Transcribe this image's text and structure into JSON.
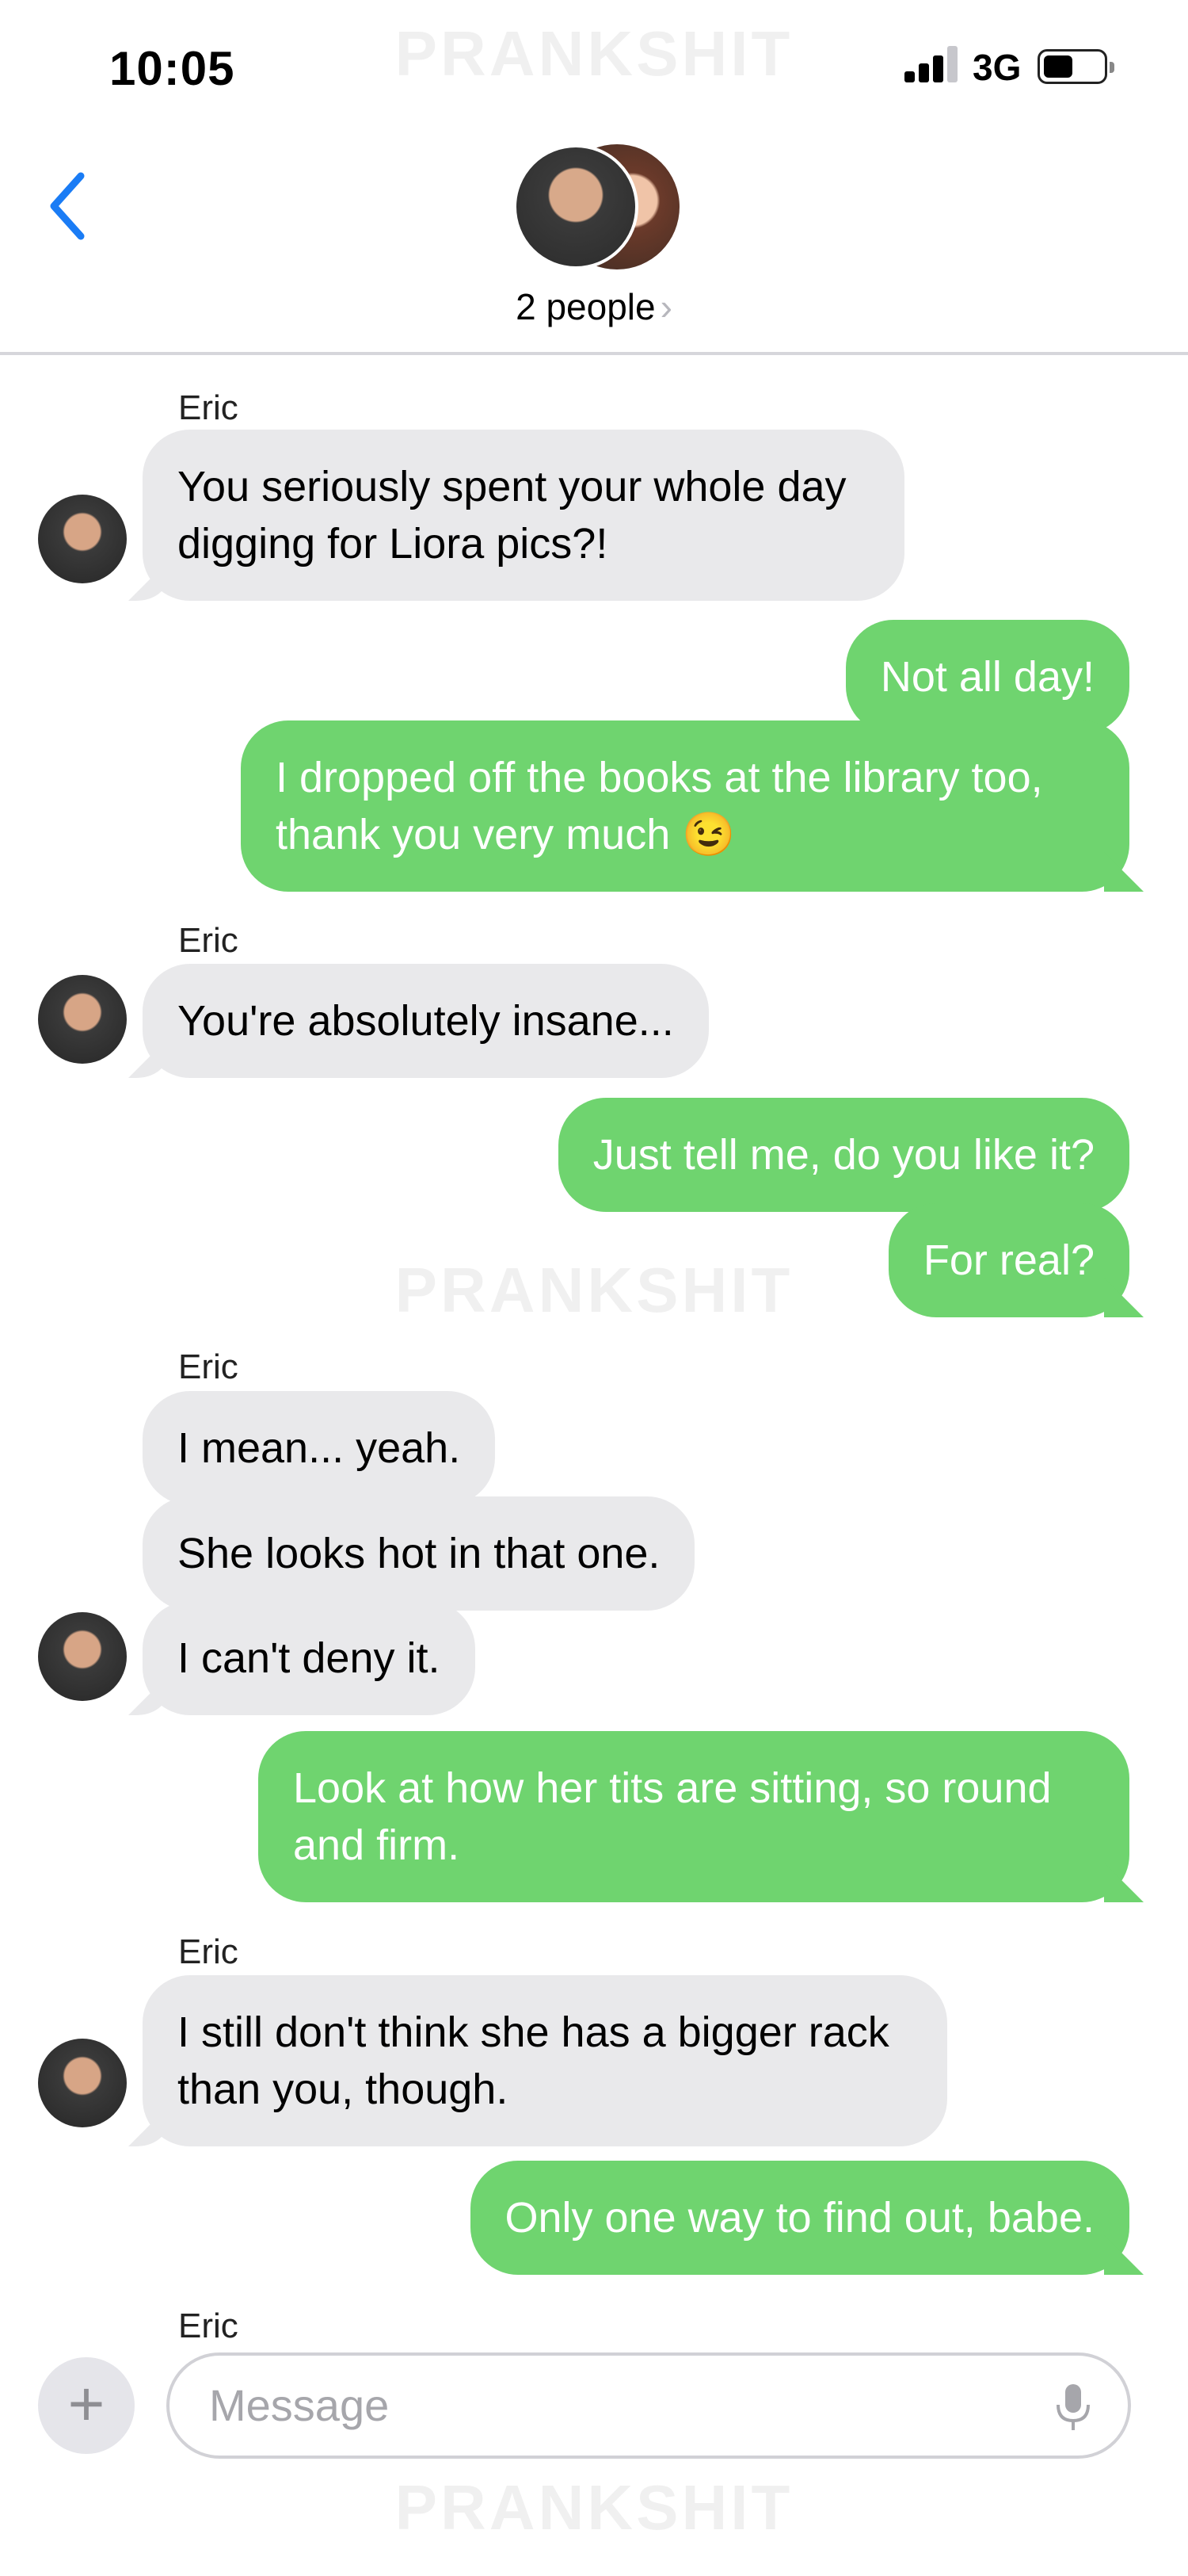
{
  "status_bar": {
    "time": "10:05",
    "network": "3G"
  },
  "watermark": "PRANKSHIT",
  "header": {
    "group_label": "2 people",
    "chevron": "›"
  },
  "messages": [
    {
      "sender": "Eric",
      "text_lines": [
        "You seriously spent your whole day",
        "digging for Liora pics?!"
      ]
    },
    {
      "text_lines": [
        "Not all day!"
      ]
    },
    {
      "text_lines": [
        "I dropped off the books at the library too,",
        "thank you very much 😉"
      ]
    },
    {
      "sender": "Eric",
      "text_lines": [
        "You're absolutely insane..."
      ]
    },
    {
      "text_lines": [
        "Just tell me, do you like it?"
      ]
    },
    {
      "text_lines": [
        "For real?"
      ]
    },
    {
      "sender": "Eric",
      "text_lines": [
        "I mean... yeah."
      ]
    },
    {
      "text_lines": [
        "She looks hot in that one."
      ]
    },
    {
      "text_lines": [
        "I can't deny it."
      ]
    },
    {
      "text_lines": [
        "Look at how her tits are sitting, so round",
        "and firm."
      ]
    },
    {
      "sender": "Eric",
      "text_lines": [
        "I still don't think she has a bigger rack",
        "than you, though."
      ]
    },
    {
      "text_lines": [
        "Only one way to find out, babe."
      ]
    },
    {
      "sender": "Eric"
    }
  ],
  "composer": {
    "plus": "+",
    "placeholder": "Message"
  }
}
